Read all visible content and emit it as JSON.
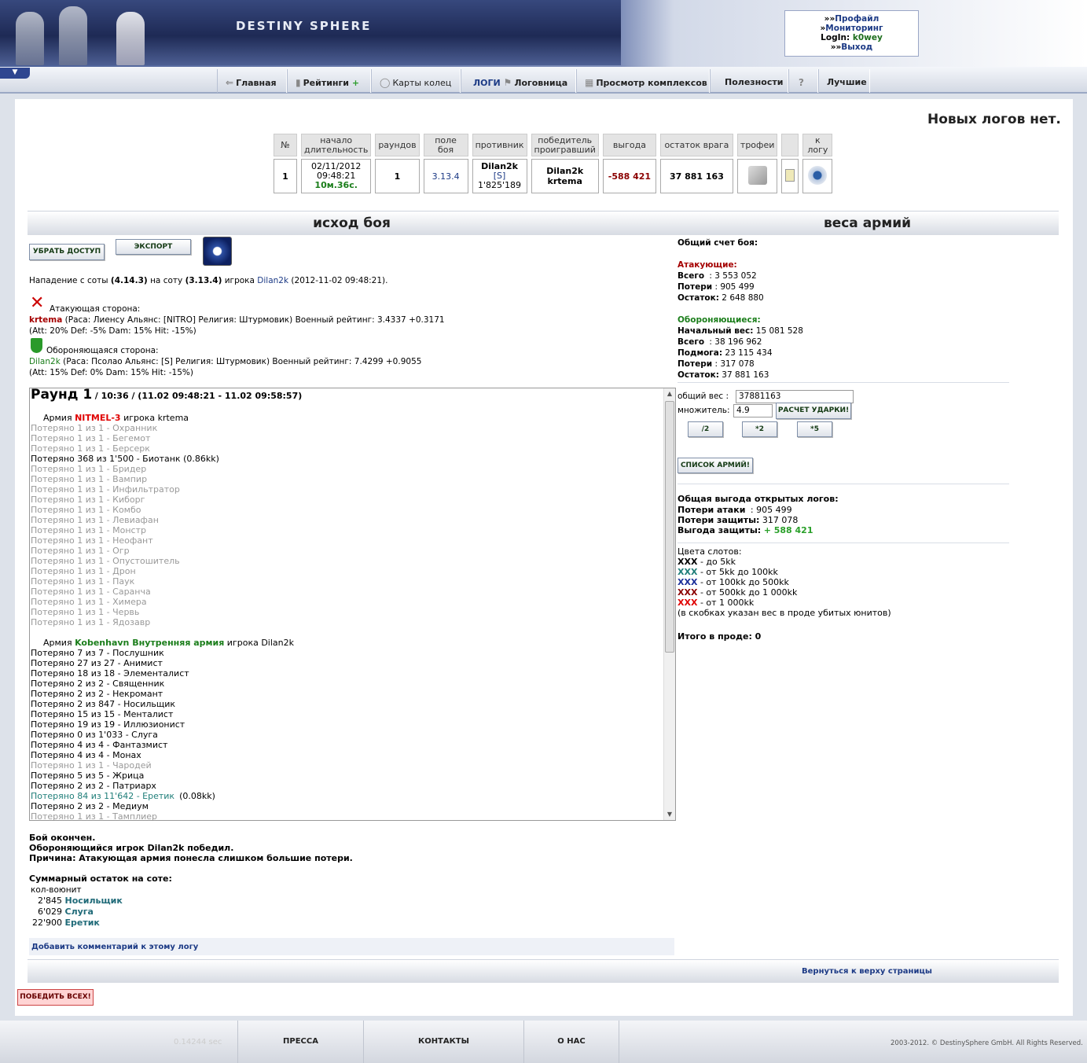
{
  "header": {
    "logo": "DESTINY SPHERE",
    "links": [
      "Профайл",
      "Мониторинг"
    ],
    "login_label": "LogIn:",
    "login_user": "k0wey",
    "logout": "Выход"
  },
  "nav": [
    {
      "label": "Главная",
      "icon": "arrow-icon"
    },
    {
      "label": "Рейтинги",
      "icon": "chart-icon",
      "plus": "+"
    },
    {
      "label": "Карты колец",
      "icon": "ring-icon"
    },
    {
      "label": "ЛОГИ",
      "icon": "",
      "accent": "#1c3a85"
    },
    {
      "label": "Логовница",
      "icon": "flag-icon"
    },
    {
      "label": "Просмотр комплексов",
      "icon": "grid-icon"
    },
    {
      "label": "Полезности",
      "icon": ""
    },
    {
      "label": "?",
      "icon": "help-icon"
    },
    {
      "label": "Лучшие",
      "icon": ""
    }
  ],
  "no_logs": "Новых логов нет.",
  "log_table": {
    "headers": [
      "№",
      "начало длительность",
      "раундов",
      "поле боя",
      "противник",
      "победитель проигравший",
      "выгода",
      "остаток врага",
      "трофеи",
      "",
      "к логу"
    ],
    "row": {
      "num": "1",
      "date": "02/11/2012",
      "time": "09:48:21",
      "duration": "10м.36с.",
      "rounds": "1",
      "field": "3.13.4",
      "opponent": "Dilan2k",
      "opponent_tag": "[S]",
      "opponent_weight": "1'825'189",
      "winner": "Dilan2k",
      "loser": "krtema",
      "profit": "-588 421",
      "rest": "37 881 163"
    }
  },
  "left": {
    "title": "исход боя",
    "btn_access": "УБРАТЬ ДОСТУП",
    "btn_export": "ЭКСПОРТ",
    "attack_text": "Нападение с соты",
    "attack_from": "(4.14.3)",
    "attack_mid": "на соту",
    "attack_to": "(3.13.4)",
    "attack_player_label": "игрока",
    "attack_player": "Dilan2k",
    "attack_date": "(2012-11-02 09:48:21).",
    "att_side": "Атакующая сторона:",
    "att_name": "krtema",
    "att_info": "(Раса: Лиенсу Альянс: [NITRO] Религия: Штурмовик) Военный рейтинг: 3.4337 +0.3171",
    "att_stats": "(Att: 20% Def: -5% Dam: 15% Hit: -15%)",
    "def_side": "Обороняющаяся сторона:",
    "def_name": "Dilan2k",
    "def_info": "(Раса: Псолао Альянс: [S] Религия: Штурмовик) Военный рейтинг: 7.4299 +0.9055",
    "def_stats": "(Att: 15% Def: 0% Dam: 15% Hit: -15%)"
  },
  "round": {
    "title": "Раунд 1",
    "time": "/ 10:36 / (11.02 09:48:21 - 11.02 09:58:57)",
    "army1_pre": "Армия",
    "army1_name": "NITMEL-3",
    "army1_post": "игрока krtema",
    "army1_lines": [
      {
        "t": "Потеряно 1 из 1 - Охранник",
        "c": "lost"
      },
      {
        "t": "Потеряно 1 из 1 - Бегемот",
        "c": "lost"
      },
      {
        "t": "Потеряно 1 из 1 - Берсерк",
        "c": "lost"
      },
      {
        "t": "Потеряно 368 из 1'500 - Биотанк  (0.86kk)",
        "c": "lostt"
      },
      {
        "t": "Потеряно 1 из 1 - Бридер",
        "c": "lost"
      },
      {
        "t": "Потеряно 1 из 1 - Вампир",
        "c": "lost"
      },
      {
        "t": "Потеряно 1 из 1 - Инфильтратор",
        "c": "lost"
      },
      {
        "t": "Потеряно 1 из 1 - Киборг",
        "c": "lost"
      },
      {
        "t": "Потеряно 1 из 1 - Комбо",
        "c": "lost"
      },
      {
        "t": "Потеряно 1 из 1 - Левиафан",
        "c": "lost"
      },
      {
        "t": "Потеряно 1 из 1 - Монстр",
        "c": "lost"
      },
      {
        "t": "Потеряно 1 из 1 - Неофант",
        "c": "lost"
      },
      {
        "t": "Потеряно 1 из 1 - Огр",
        "c": "lost"
      },
      {
        "t": "Потеряно 1 из 1 - Опустошитель",
        "c": "lost"
      },
      {
        "t": "Потеряно 1 из 1 - Дрон",
        "c": "lost"
      },
      {
        "t": "Потеряно 1 из 1 - Паук",
        "c": "lost"
      },
      {
        "t": "Потеряно 1 из 1 - Саранча",
        "c": "lost"
      },
      {
        "t": "Потеряно 1 из 1 - Химера",
        "c": "lost"
      },
      {
        "t": "Потеряно 1 из 1 - Червь",
        "c": "lost"
      },
      {
        "t": "Потеряно 1 из 1 - Ядозавр",
        "c": "lost"
      }
    ],
    "army2_pre": "Армия",
    "army2_name": "Kobenhavn Внутренняя армия",
    "army2_post": "игрока Dilan2k",
    "army2_lines": [
      {
        "t": "Потеряно 7 из 7 - Послушник",
        "c": "lostt"
      },
      {
        "t": "Потеряно 27 из 27 - Анимист",
        "c": "lostt"
      },
      {
        "t": "Потеряно 18 из 18 - Элементалист",
        "c": "lostt"
      },
      {
        "t": "Потеряно 2 из 2 - Священник",
        "c": "lostt"
      },
      {
        "t": "Потеряно 2 из 2 - Некромант",
        "c": "lostt"
      },
      {
        "t": "Потеряно 2 из 847 - Носильщик",
        "c": "lostt"
      },
      {
        "t": "Потеряно 15 из 15 - Менталист",
        "c": "lostt"
      },
      {
        "t": "Потеряно 19 из 19 - Иллюзионист",
        "c": "lostt"
      },
      {
        "t": "Потеряно 0 из 1'033 - Слуга",
        "c": "lostt"
      },
      {
        "t": "Потеряно 4 из 4 - Фантазмист",
        "c": "lostt"
      },
      {
        "t": "Потеряно 4 из 4 - Монах",
        "c": "lostt"
      },
      {
        "t": "Потеряно 1 из 1 - Чародей",
        "c": "lost"
      },
      {
        "t": "Потеряно 5 из 5 - Жрица",
        "c": "lostt"
      },
      {
        "t": "Потеряно 2 из 2 - Патриарх",
        "c": "lostt"
      },
      {
        "t": "Потеряно 84 из 11'642 - Еретик",
        "c": "hl",
        "extra": "(0.08kk)"
      },
      {
        "t": "Потеряно 2 из 2 - Медиум",
        "c": "lostt"
      },
      {
        "t": "Потеряно 1 из 1 - Тамплиер",
        "c": "lost"
      }
    ]
  },
  "result": {
    "l1": "Бой окончен.",
    "l2": "Обороняющийся игрок Dilan2k победил.",
    "l3": "Причина: Атакующая армия понесла слишком большие потери.",
    "sum_title": "Суммарный остаток на соте:",
    "sum_hdr": "кол-воюнит",
    "sum": [
      {
        "n": "2'845",
        "u": "Носильщик"
      },
      {
        "n": "6'029",
        "u": "Слуга"
      },
      {
        "n": "22'900",
        "u": "Еретик"
      }
    ],
    "comment": "Добавить комментарий к этому логу",
    "back_top": "Вернуться к верху страницы",
    "beat_all": "ПОБЕДИТЬ ВСЕХ!"
  },
  "right": {
    "title": "веса армий",
    "total": "Общий счет боя:",
    "att": "Атакующие:",
    "att_all_l": "Всего",
    "att_all": ": 3 553 052",
    "att_loss_l": "Потери",
    "att_loss": ": 905 499",
    "att_rest_l": "Остаток:",
    "att_rest": "2 648 880",
    "def": "Обороняющиеся:",
    "def_start_l": "Начальный вес:",
    "def_start": "15 081 528",
    "def_all_l": "Всего",
    "def_all": ": 38 196 962",
    "def_help_l": "Подмога:",
    "def_help": "23 115 434",
    "def_loss_l": "Потери",
    "def_loss": ": 317 078",
    "def_rest_l": "Остаток:",
    "def_rest": "37 881 163",
    "weight_l": "общий вес :",
    "weight_v": "37881163",
    "mult_l": "множитель:",
    "mult_v": "4.9",
    "calc_btn": "РАСЧЕТ УДАРКИ!",
    "d2": "/2",
    "m2": "*2",
    "m5": "*5",
    "armies_btn": "СПИСОК АРМИЙ!",
    "open_profit": "Общая выгода открытых логов:",
    "p_att_l": "Потери атаки",
    "p_att": ": 905 499",
    "p_def_l": "Потери защиты:",
    "p_def": "317 078",
    "p_gain_l": "Выгода защиты:",
    "p_gain": "+ 588 421",
    "slots": "Цвета слотов:",
    "slot_rows": [
      {
        "x": "XXX",
        "t": "- до 5kk",
        "c": "#000000"
      },
      {
        "x": "XXX",
        "t": "- от 5kk до 100kk",
        "c": "#1f7e79"
      },
      {
        "x": "XXX",
        "t": "- от 100kk до 500kk",
        "c": "#1c2f9a"
      },
      {
        "x": "XXX",
        "t": "- от 500kk до 1 000kk",
        "c": "#8b0000"
      },
      {
        "x": "XXX",
        "t": "- от 1 000kk",
        "c": "#e00000"
      }
    ],
    "slot_note": "(в скобках указан вес в проде убитых юнитов)",
    "total_prod": "Итого в проде: 0"
  },
  "footer": {
    "time": "0.14244 sec",
    "press": "ПРЕССА",
    "contacts": "КОНТАКТЫ",
    "about": "О НАС",
    "copyright": "2003-2012. © DestinySphere GmbH. All Rights Reserved."
  }
}
